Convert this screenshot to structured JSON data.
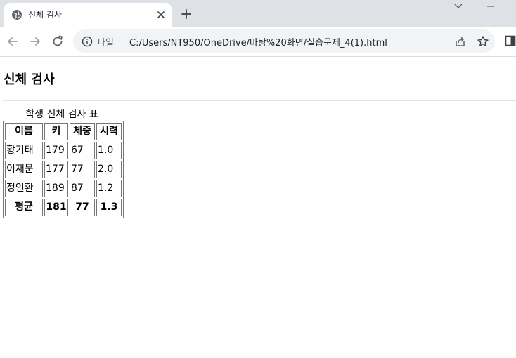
{
  "browser": {
    "tab": {
      "title": "신체 검사"
    },
    "address_bar": {
      "scheme_label": "파일",
      "url": "C:/Users/NT950/OneDrive/바탕%20화면/실습문제_4(1).html"
    }
  },
  "page": {
    "heading": "신체 검사",
    "table": {
      "caption": "학생 신체 검사 표",
      "headers": [
        "이름",
        "키",
        "체중",
        "시력"
      ],
      "rows": [
        [
          "황기태",
          "179",
          "67",
          "1.0"
        ],
        [
          "이재문",
          "177",
          "77",
          "2.0"
        ],
        [
          "정인환",
          "189",
          "87",
          "1.2"
        ]
      ],
      "footer": [
        "평균",
        "181",
        "77",
        "1.3"
      ]
    }
  },
  "icons": {
    "favicon": "globe-icon",
    "tab_close": "close-icon",
    "new_tab": "plus-icon",
    "back": "back-arrow-icon",
    "forward": "forward-arrow-icon",
    "reload": "reload-icon",
    "site_info": "info-icon",
    "share": "share-icon",
    "bookmark": "star-icon",
    "side_panel": "side-panel-icon",
    "tab_search": "chevron-down-icon",
    "minimize": "minimize-icon"
  },
  "colors": {
    "tabstrip_bg": "#dee1e6",
    "omnibox_bg": "#f1f3f4",
    "icon_gray": "#5f6368",
    "table_border": "#767676"
  }
}
